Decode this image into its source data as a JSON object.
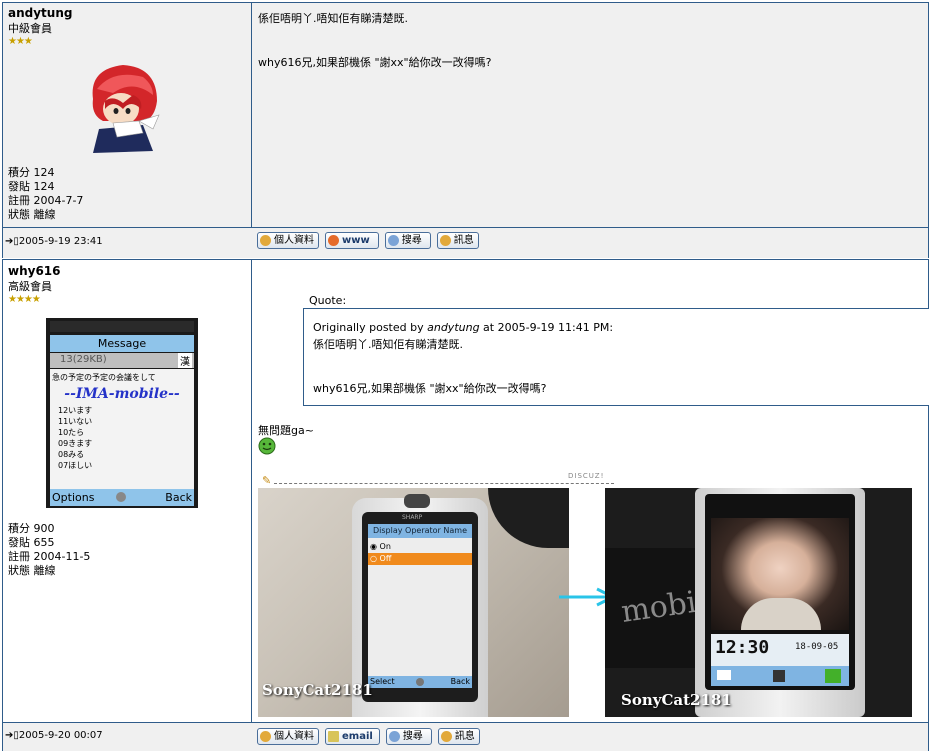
{
  "posts": [
    {
      "user": {
        "name": "andytung",
        "rank": "中級會員",
        "stars": "★★★",
        "stats": [
          "積分 124",
          "發貼 124",
          "註冊 2004-7-7",
          "狀態 離線"
        ]
      },
      "message": {
        "line1": "係佢唔明丫.唔知佢有睇清楚既.",
        "line2": "why616兄,如果部機係 \"謝xx\"給你改一改得嗎?"
      },
      "footer": {
        "time": "2005-9-19 23:41",
        "buttons": [
          "個人資料",
          "www",
          "搜尋",
          "訊息"
        ]
      }
    },
    {
      "user": {
        "name": "why616",
        "rank": "高級會員",
        "stars": "★★★★",
        "stats": [
          "積分 900",
          "發貼 655",
          "註冊 2004-11-5",
          "狀態 離線"
        ]
      },
      "avatar_phone": {
        "header": "Message",
        "sub": "13(29KB)",
        "kanji": "漢",
        "text": "急の予定の予定の会議をして",
        "watermark": "--IMA-mobile--",
        "list": [
          "12います",
          "11いない",
          "10たら",
          "09きます",
          "08みる",
          "07ほしい"
        ],
        "left_soft": "Options",
        "right_soft": "Back"
      },
      "quote": {
        "label": "Quote:",
        "intro_pre": "Originally posted by ",
        "author": "andytung",
        "intro_post": " at 2005-9-19 11:41 PM:",
        "line1": "係佢唔明丫.唔知佢有睇清楚既.",
        "line2": "why616兄,如果部機係 \"謝xx\"給你改一改得嗎?"
      },
      "reply": "無問題ga~",
      "discuz": "DISCUZ!",
      "photo1": {
        "brand": "SHARP",
        "menu_title": "Display Operator Name",
        "opt_on": "On",
        "opt_off": "Off",
        "soft_left": "Select",
        "soft_right": "Back",
        "caption": "SonyCat2181"
      },
      "photo2": {
        "clock": "12:30",
        "date": "18-09-05",
        "lanyard": "mobile",
        "caption": "SonyCat2181"
      },
      "footer": {
        "time": "2005-9-20 00:07",
        "buttons": [
          "個人資料",
          "email",
          "搜尋",
          "訊息"
        ]
      }
    }
  ],
  "colors": {
    "border": "#2f5c8a",
    "post1_bg": "#f0f0f0",
    "arrow": "#29c4e8",
    "highlight": "#f08a1c"
  }
}
